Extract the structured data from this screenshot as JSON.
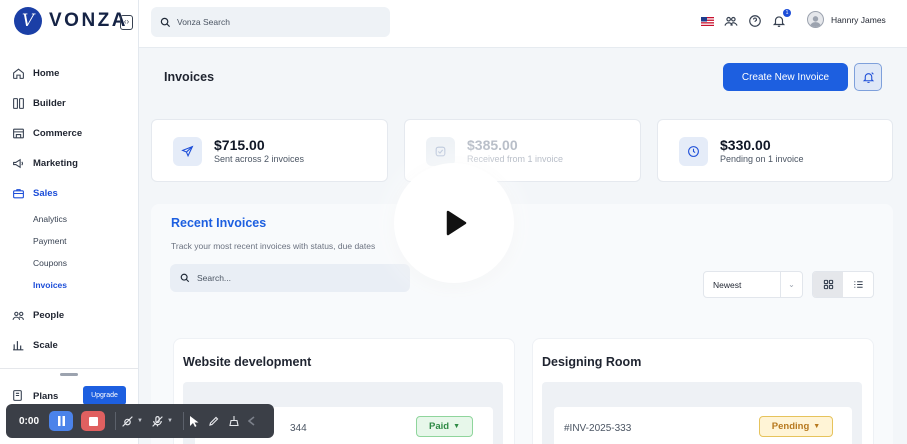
{
  "app": {
    "brand": "VONZA",
    "logo_letter": "V"
  },
  "topbar": {
    "search_placeholder": "Vonza Search",
    "notification_count": "1",
    "user_name": "Hannry James",
    "icons": [
      "flag-us-icon",
      "users-icon",
      "help-icon",
      "bell-icon"
    ]
  },
  "sidebar": {
    "items": [
      {
        "label": "Home",
        "icon": "home-icon"
      },
      {
        "label": "Builder",
        "icon": "builder-icon"
      },
      {
        "label": "Commerce",
        "icon": "store-icon"
      },
      {
        "label": "Marketing",
        "icon": "megaphone-icon"
      },
      {
        "label": "Sales",
        "icon": "briefcase-icon",
        "active": true
      }
    ],
    "sales_sub": [
      "Analytics",
      "Payment",
      "Coupons",
      "Invoices"
    ],
    "active_sub": "Invoices",
    "bottom_items": [
      {
        "label": "People",
        "icon": "people-icon"
      },
      {
        "label": "Scale",
        "icon": "chart-icon"
      }
    ],
    "plans_label": "Plans",
    "upgrade_label": "Upgrade"
  },
  "page": {
    "title": "Invoices",
    "create_button": "Create New Invoice"
  },
  "stats": [
    {
      "value": "$715.00",
      "label": "Sent across 2 invoices",
      "icon": "send-icon"
    },
    {
      "value": "$385.00",
      "label": "Received from 1 invoice",
      "icon": "check-icon"
    },
    {
      "value": "$330.00",
      "label": "Pending on 1 invoice",
      "icon": "clock-icon"
    }
  ],
  "recent": {
    "title": "Recent Invoices",
    "subtitle": "Track your most recent invoices with status, due dates",
    "search_placeholder": "Search...",
    "sort_value": "Newest"
  },
  "invoice_cards": [
    {
      "title": "Website development",
      "number": "344",
      "status": "Paid"
    },
    {
      "title": "Designing Room",
      "number": "#INV-2025-333",
      "status": "Pending"
    }
  ],
  "recorder": {
    "time": "0:00"
  },
  "colors": {
    "accent": "#1d5fe0",
    "paid": "#2f8a45",
    "pending": "#b7791f",
    "recorder_bg": "#3b3f47"
  }
}
